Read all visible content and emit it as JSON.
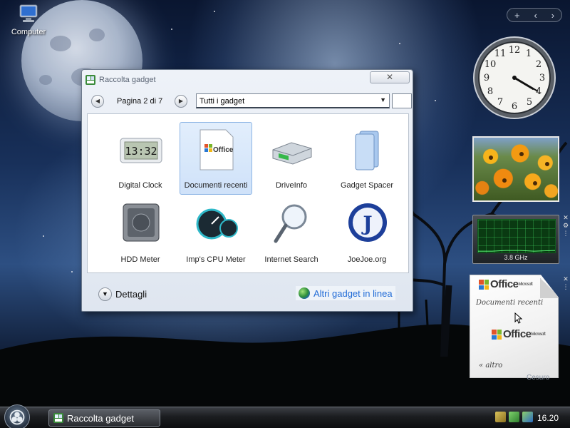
{
  "desktop": {
    "icons": [
      {
        "label": "Computer",
        "icon": "computer-icon"
      }
    ],
    "user_name": "Cesuro"
  },
  "sidebar": {
    "controls": {
      "add": "+",
      "prev": "‹",
      "next": "›"
    },
    "clock": {
      "hour": 4,
      "minute": 20
    },
    "cpu_meter": {
      "frequency": "3.8 GHz"
    },
    "recent_documents": {
      "title": "Documenti recenti",
      "more_label": "altro",
      "more_prefix": "«",
      "logo_text": "Office",
      "logo_super": "Microsoft"
    }
  },
  "gallery": {
    "title": "Raccolta gadget",
    "close_label": "✕",
    "page_label": "Pagina 2 di 7",
    "filter": {
      "selected": "Tutti i gadget"
    },
    "items": [
      {
        "label": "Digital Clock",
        "clock_text": "13:32",
        "selected": false
      },
      {
        "label": "Documenti recenti",
        "selected": true
      },
      {
        "label": "DriveInfo",
        "selected": false
      },
      {
        "label": "Gadget Spacer",
        "selected": false
      },
      {
        "label": "HDD Meter",
        "selected": false
      },
      {
        "label": "Imp's CPU Meter",
        "selected": false
      },
      {
        "label": "Internet Search",
        "selected": false
      },
      {
        "label": "JoeJoe.org",
        "letter": "J",
        "selected": false
      }
    ],
    "details_label": "Dettagli",
    "more_online_label": "Altri gadget in linea"
  },
  "taskbar": {
    "task_label": "Raccolta gadget",
    "time": "16.20"
  },
  "colors": {
    "link": "#1f6ad6",
    "selection": "#cfe2f9",
    "cpu_screen": "#0a3a12"
  }
}
